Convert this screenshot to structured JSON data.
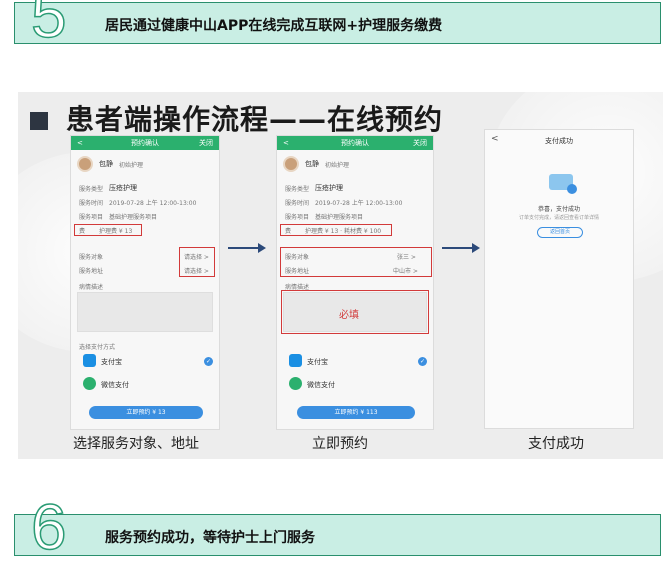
{
  "banner5": {
    "number": "5",
    "text": "居民通过健康中山APP在线完成互联网+护理服务缴费"
  },
  "panel": {
    "heading": "患者端操作流程——在线预约",
    "phone1": {
      "back": "<",
      "title": "预约确认",
      "close": "关闭",
      "name": "包静",
      "tag": "初始护理",
      "service_label": "服务类型",
      "service_value": "压疮护理",
      "time_label": "服务时间",
      "time_value": "2019-07-28 上午 12:00-13:00",
      "item_label": "服务项目",
      "item_value": "基础护理服务项目",
      "fee_label": "费",
      "fee_value": "护理费 ¥ 13",
      "obj_label": "服务对象",
      "obj_value": "请选择 >",
      "addr_label": "服务地址",
      "addr_value": "请选择 >",
      "desc_label": "病情描述",
      "pay_label": "选择支付方式",
      "alipay": "支付宝",
      "wechat": "微信支付",
      "submit": "立即预约 ¥ 13"
    },
    "phone2": {
      "back": "<",
      "title": "预约确认",
      "close": "关闭",
      "name": "包静",
      "tag": "初始护理",
      "service_label": "服务类型",
      "service_value": "压疮护理",
      "time_label": "服务时间",
      "time_value": "2019-07-28 上午 12:00-13:00",
      "item_label": "服务项目",
      "item_value": "基础护理服务项目",
      "fee_label": "费",
      "fee_value": "护理费 ¥ 13 · 耗材费 ¥ 100",
      "obj_label": "服务对象",
      "obj_value": "张三 >",
      "addr_label": "服务地址",
      "addr_value": "中山市 >",
      "desc_label": "病情描述",
      "required": "必填",
      "alipay": "支付宝",
      "wechat": "微信支付",
      "submit": "立即预约 ¥ 113"
    },
    "phone3": {
      "back": "<",
      "title": "支付成功",
      "msg": "恭喜，支付成功",
      "sub": "订单支付完成，请返回查看订单详情",
      "button": "返回首页"
    },
    "captions": [
      "选择服务对象、地址",
      "立即预约",
      "支付成功"
    ]
  },
  "banner6": {
    "number": "6",
    "text": "服务预约成功，等待护士上门服务"
  },
  "colors": {
    "banner_bg": "#c9eee4",
    "banner_border": "#2a8f6d",
    "phone_header": "#2bb06e",
    "red": "#d23a3a",
    "arrow": "#2c4a7a"
  }
}
